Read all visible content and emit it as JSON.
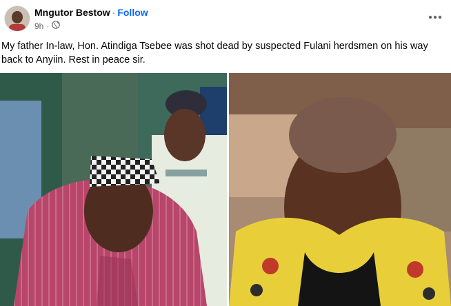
{
  "post": {
    "author": "Mngutor Bestow",
    "separator": "·",
    "follow_label": "Follow",
    "time": "9h",
    "meta_separator": "·",
    "privacy_icon": "globe-icon",
    "more_icon": "more-options-icon",
    "caption": "My father In-law, Hon. Atindiga Tsebee was shot dead by suspected Fulani herdsmen on his way back to Anyiin. Rest in peace sir."
  },
  "colors": {
    "follow": "#0866ff",
    "secondary_text": "#65676b"
  }
}
